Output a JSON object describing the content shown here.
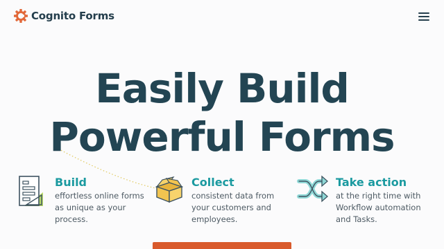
{
  "brand": {
    "name": "Cognito Forms",
    "accent": "#e2693a"
  },
  "nav": {
    "menu_icon": "hamburger-menu-icon"
  },
  "hero": {
    "title_line1": "Easily Build",
    "title_line2": "Powerful Forms"
  },
  "features": [
    {
      "title": "Build",
      "icon": "form-document-icon",
      "desc": "effortless online forms as unique as your process."
    },
    {
      "title": "Collect",
      "icon": "open-box-icon",
      "desc": "consistent data from your customers and employees."
    },
    {
      "title": "Take action",
      "icon": "shuffle-arrows-icon",
      "desc": "at the right time with Workflow automation and Tasks."
    }
  ],
  "colors": {
    "heading": "#234553",
    "teal": "#1b9aa0",
    "cta": "#d95a2c"
  }
}
